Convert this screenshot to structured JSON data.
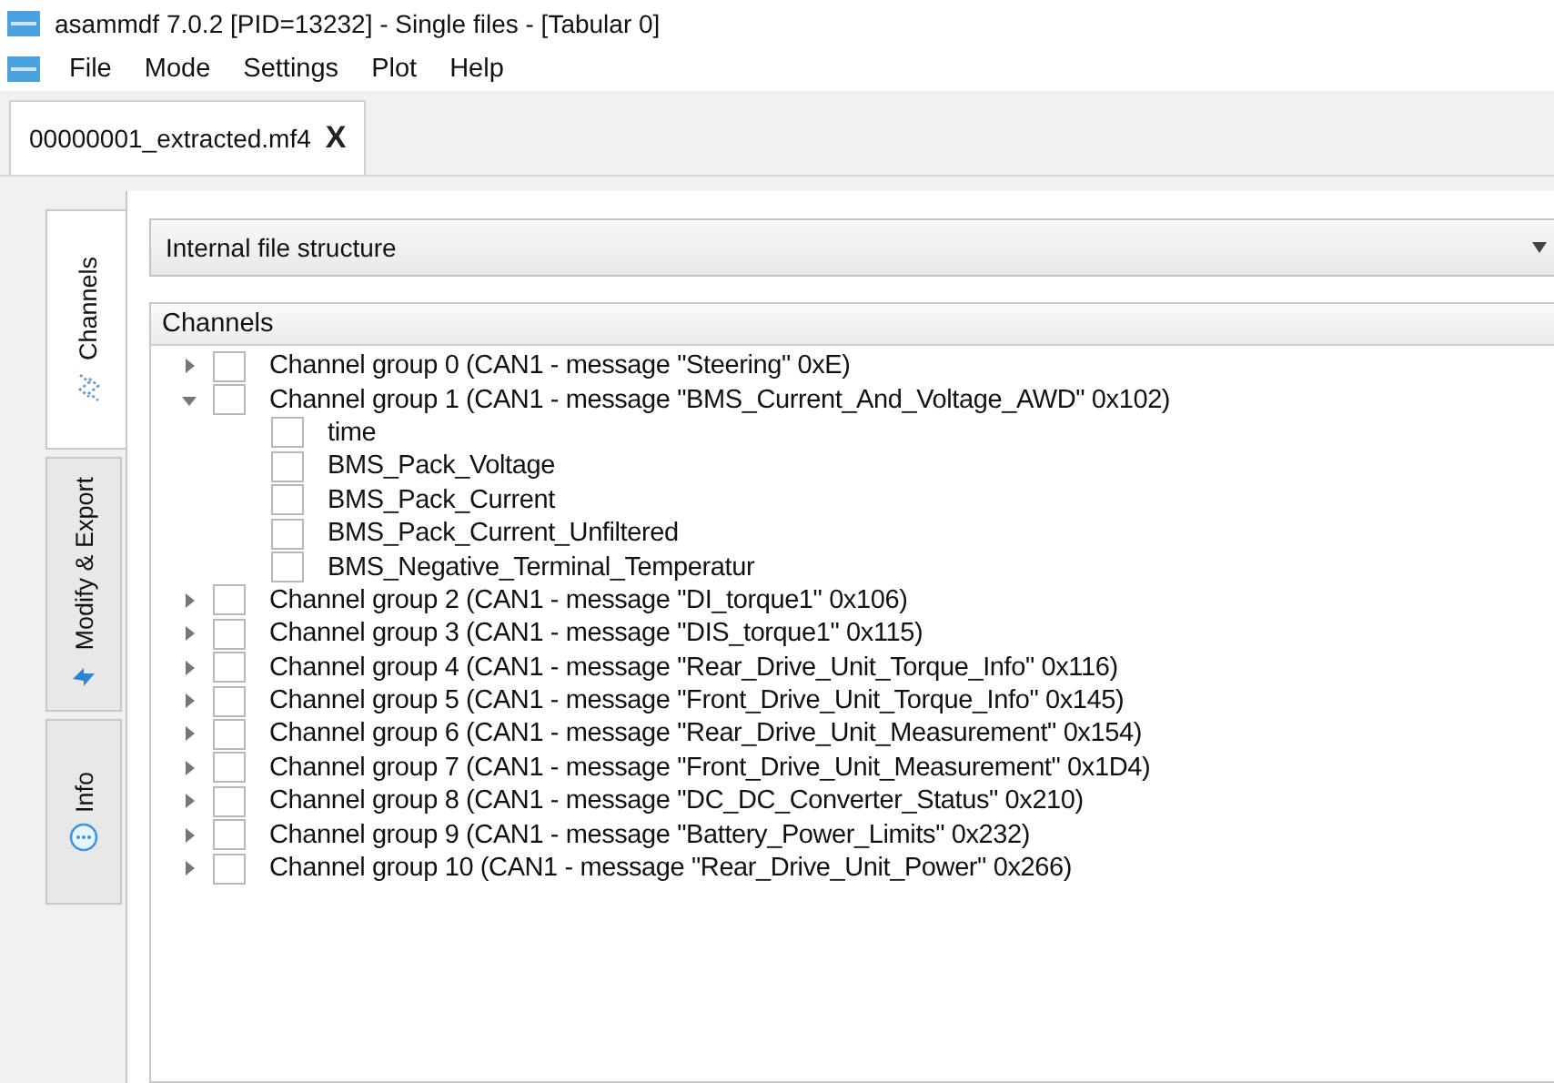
{
  "window": {
    "title": "asammdf 7.0.2 [PID=13232] - Single files - [Tabular 0]"
  },
  "menu": [
    "File",
    "Mode",
    "Settings",
    "Plot",
    "Help"
  ],
  "file_tabs": [
    {
      "label": "00000001_extracted.mf4",
      "close": "X",
      "selected": true
    }
  ],
  "side_tabs": [
    {
      "label": "Channels",
      "kind": "channels",
      "selected": true
    },
    {
      "label": "Modify & Export",
      "kind": "modify",
      "selected": false
    },
    {
      "label": "Info",
      "kind": "info",
      "selected": false
    }
  ],
  "view_select": {
    "value": "Internal file structure"
  },
  "tree": {
    "header": "Channels",
    "items": [
      {
        "label": "Channel group 0 (CAN1 - message \"Steering\" 0xE)",
        "checked": false,
        "expanded": false
      },
      {
        "label": "Channel group 1 (CAN1 - message \"BMS_Current_And_Voltage_AWD\" 0x102)",
        "checked": false,
        "expanded": true,
        "children": [
          {
            "label": "time",
            "checked": false
          },
          {
            "label": "BMS_Pack_Voltage",
            "checked": false
          },
          {
            "label": "BMS_Pack_Current",
            "checked": false
          },
          {
            "label": "BMS_Pack_Current_Unfiltered",
            "checked": false
          },
          {
            "label": "BMS_Negative_Terminal_Temperatur",
            "checked": false
          }
        ]
      },
      {
        "label": "Channel group 2 (CAN1 - message \"DI_torque1\" 0x106)",
        "checked": false,
        "expanded": false
      },
      {
        "label": "Channel group 3 (CAN1 - message \"DIS_torque1\" 0x115)",
        "checked": false,
        "expanded": false
      },
      {
        "label": "Channel group 4 (CAN1 - message \"Rear_Drive_Unit_Torque_Info\" 0x116)",
        "checked": false,
        "expanded": false
      },
      {
        "label": "Channel group 5 (CAN1 - message \"Front_Drive_Unit_Torque_Info\" 0x145)",
        "checked": false,
        "expanded": false
      },
      {
        "label": "Channel group 6 (CAN1 - message \"Rear_Drive_Unit_Measurement\" 0x154)",
        "checked": false,
        "expanded": false
      },
      {
        "label": "Channel group 7 (CAN1 - message \"Front_Drive_Unit_Measurement\" 0x1D4)",
        "checked": false,
        "expanded": false
      },
      {
        "label": "Channel group 8 (CAN1 - message \"DC_DC_Converter_Status\" 0x210)",
        "checked": false,
        "expanded": false
      },
      {
        "label": "Channel group 9 (CAN1 - message \"Battery_Power_Limits\" 0x232)",
        "checked": false,
        "expanded": false
      },
      {
        "label": "Channel group 10 (CAN1 - message \"Rear_Drive_Unit_Power\" 0x266)",
        "checked": false,
        "expanded": false
      }
    ]
  }
}
